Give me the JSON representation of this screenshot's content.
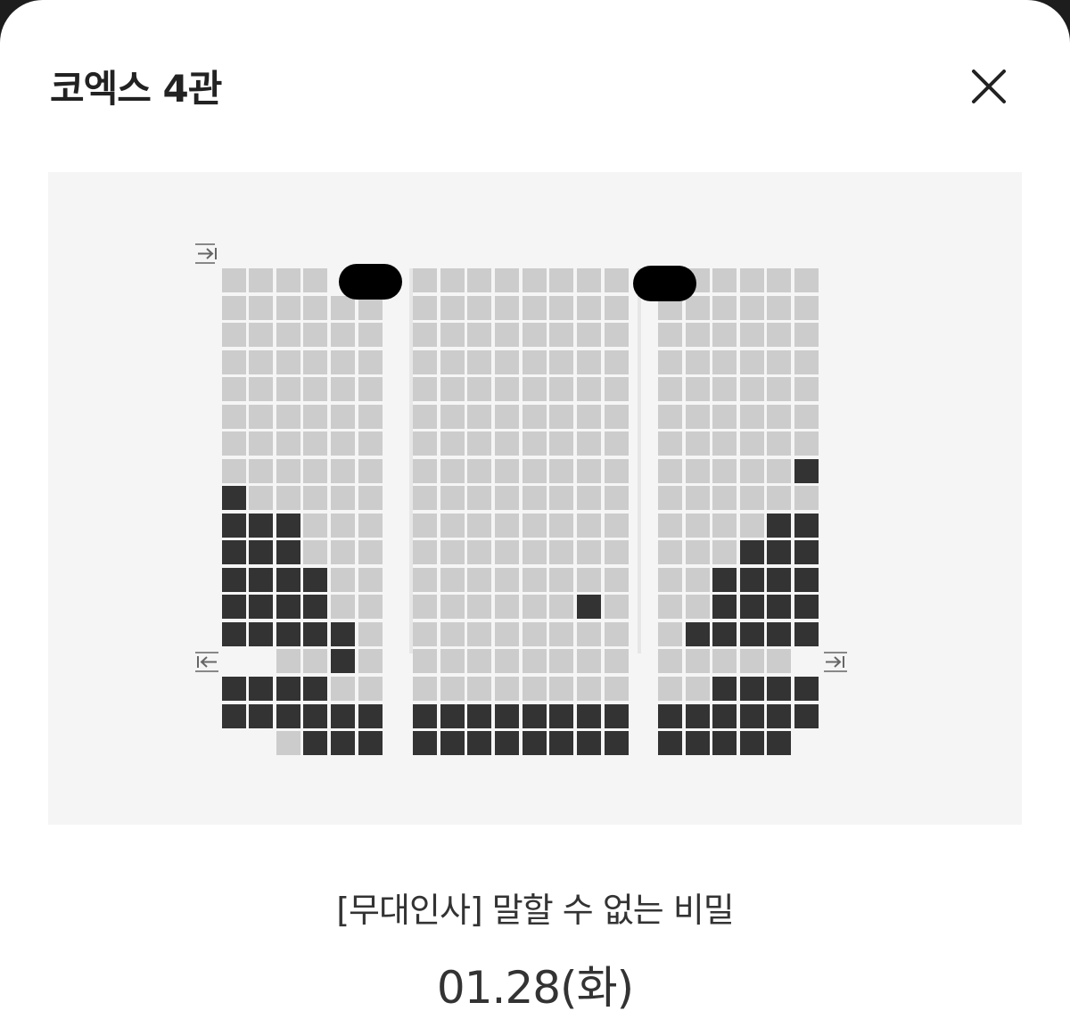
{
  "header": {
    "title": "코엑스 4관",
    "close_icon": "close-icon"
  },
  "seat_map": {
    "colors": {
      "available": "#cccccc",
      "taken": "#333333",
      "background": "#f5f5f5"
    },
    "icons": {
      "entrance": "exit-arrow-right-icon",
      "exit": "exit-arrow-left-icon",
      "pillar": "pillar"
    },
    "taken_seats": [
      "8-0",
      "9-0",
      "9-1",
      "9-2",
      "10-0",
      "10-1",
      "10-2",
      "11-0",
      "11-1",
      "11-2",
      "11-3",
      "12-0",
      "12-1",
      "12-2",
      "12-3",
      "13-0",
      "13-1",
      "13-2",
      "13-3",
      "13-4",
      "14-4",
      "7-21",
      "9-20",
      "9-21",
      "10-19",
      "10-20",
      "10-21",
      "11-18",
      "11-19",
      "11-20",
      "11-21",
      "12-18",
      "12-19",
      "12-20",
      "12-21",
      "13-17",
      "13-18",
      "13-19",
      "13-20",
      "13-21",
      "12-12",
      "15-0",
      "15-1",
      "15-2",
      "15-3",
      "16-0",
      "16-1",
      "16-2",
      "16-3",
      "16-4",
      "16-5",
      "17-3",
      "17-4",
      "17-5",
      "16-6",
      "16-7",
      "16-8",
      "16-9",
      "16-10",
      "16-11",
      "16-12",
      "16-13",
      "17-6",
      "17-7",
      "17-8",
      "17-9",
      "17-10",
      "17-11",
      "17-12",
      "17-13",
      "15-18",
      "15-19",
      "15-20",
      "15-21",
      "16-16",
      "16-17",
      "16-18",
      "16-19",
      "16-20",
      "16-21",
      "17-16",
      "17-17",
      "17-18",
      "17-19",
      "17-20"
    ]
  },
  "movie": {
    "title": "[무대인사] 말할 수 없는 비밀",
    "date": "01.28(화)"
  }
}
